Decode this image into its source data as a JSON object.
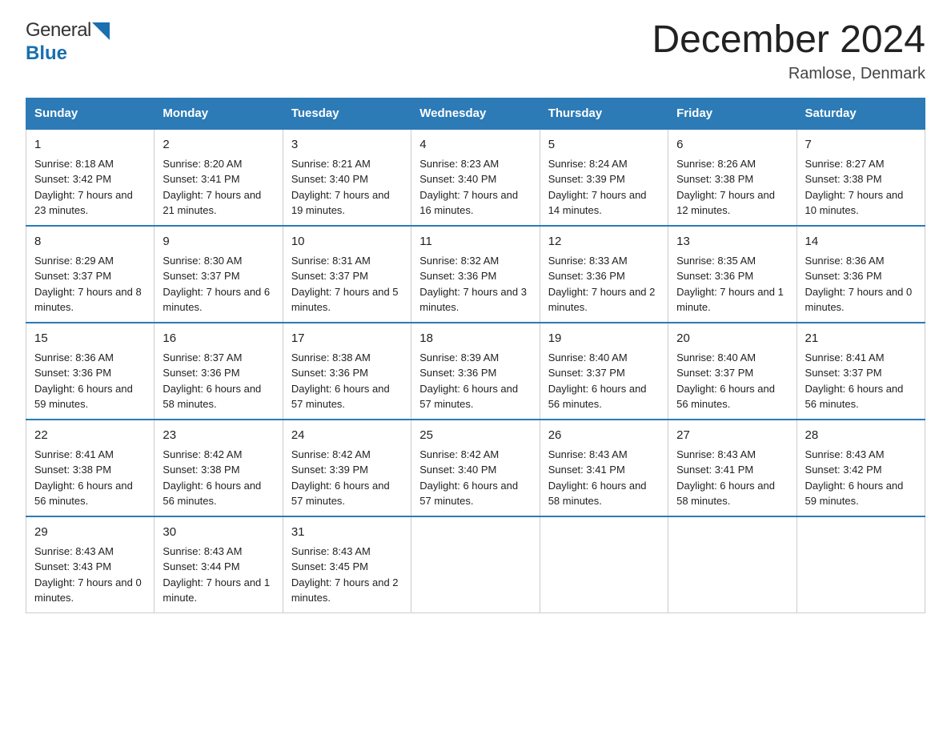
{
  "header": {
    "logo_general": "General",
    "logo_blue": "Blue",
    "title": "December 2024",
    "subtitle": "Ramlose, Denmark"
  },
  "days_of_week": [
    "Sunday",
    "Monday",
    "Tuesday",
    "Wednesday",
    "Thursday",
    "Friday",
    "Saturday"
  ],
  "weeks": [
    [
      {
        "day": "1",
        "sunrise": "8:18 AM",
        "sunset": "3:42 PM",
        "daylight": "7 hours and 23 minutes."
      },
      {
        "day": "2",
        "sunrise": "8:20 AM",
        "sunset": "3:41 PM",
        "daylight": "7 hours and 21 minutes."
      },
      {
        "day": "3",
        "sunrise": "8:21 AM",
        "sunset": "3:40 PM",
        "daylight": "7 hours and 19 minutes."
      },
      {
        "day": "4",
        "sunrise": "8:23 AM",
        "sunset": "3:40 PM",
        "daylight": "7 hours and 16 minutes."
      },
      {
        "day": "5",
        "sunrise": "8:24 AM",
        "sunset": "3:39 PM",
        "daylight": "7 hours and 14 minutes."
      },
      {
        "day": "6",
        "sunrise": "8:26 AM",
        "sunset": "3:38 PM",
        "daylight": "7 hours and 12 minutes."
      },
      {
        "day": "7",
        "sunrise": "8:27 AM",
        "sunset": "3:38 PM",
        "daylight": "7 hours and 10 minutes."
      }
    ],
    [
      {
        "day": "8",
        "sunrise": "8:29 AM",
        "sunset": "3:37 PM",
        "daylight": "7 hours and 8 minutes."
      },
      {
        "day": "9",
        "sunrise": "8:30 AM",
        "sunset": "3:37 PM",
        "daylight": "7 hours and 6 minutes."
      },
      {
        "day": "10",
        "sunrise": "8:31 AM",
        "sunset": "3:37 PM",
        "daylight": "7 hours and 5 minutes."
      },
      {
        "day": "11",
        "sunrise": "8:32 AM",
        "sunset": "3:36 PM",
        "daylight": "7 hours and 3 minutes."
      },
      {
        "day": "12",
        "sunrise": "8:33 AM",
        "sunset": "3:36 PM",
        "daylight": "7 hours and 2 minutes."
      },
      {
        "day": "13",
        "sunrise": "8:35 AM",
        "sunset": "3:36 PM",
        "daylight": "7 hours and 1 minute."
      },
      {
        "day": "14",
        "sunrise": "8:36 AM",
        "sunset": "3:36 PM",
        "daylight": "7 hours and 0 minutes."
      }
    ],
    [
      {
        "day": "15",
        "sunrise": "8:36 AM",
        "sunset": "3:36 PM",
        "daylight": "6 hours and 59 minutes."
      },
      {
        "day": "16",
        "sunrise": "8:37 AM",
        "sunset": "3:36 PM",
        "daylight": "6 hours and 58 minutes."
      },
      {
        "day": "17",
        "sunrise": "8:38 AM",
        "sunset": "3:36 PM",
        "daylight": "6 hours and 57 minutes."
      },
      {
        "day": "18",
        "sunrise": "8:39 AM",
        "sunset": "3:36 PM",
        "daylight": "6 hours and 57 minutes."
      },
      {
        "day": "19",
        "sunrise": "8:40 AM",
        "sunset": "3:37 PM",
        "daylight": "6 hours and 56 minutes."
      },
      {
        "day": "20",
        "sunrise": "8:40 AM",
        "sunset": "3:37 PM",
        "daylight": "6 hours and 56 minutes."
      },
      {
        "day": "21",
        "sunrise": "8:41 AM",
        "sunset": "3:37 PM",
        "daylight": "6 hours and 56 minutes."
      }
    ],
    [
      {
        "day": "22",
        "sunrise": "8:41 AM",
        "sunset": "3:38 PM",
        "daylight": "6 hours and 56 minutes."
      },
      {
        "day": "23",
        "sunrise": "8:42 AM",
        "sunset": "3:38 PM",
        "daylight": "6 hours and 56 minutes."
      },
      {
        "day": "24",
        "sunrise": "8:42 AM",
        "sunset": "3:39 PM",
        "daylight": "6 hours and 57 minutes."
      },
      {
        "day": "25",
        "sunrise": "8:42 AM",
        "sunset": "3:40 PM",
        "daylight": "6 hours and 57 minutes."
      },
      {
        "day": "26",
        "sunrise": "8:43 AM",
        "sunset": "3:41 PM",
        "daylight": "6 hours and 58 minutes."
      },
      {
        "day": "27",
        "sunrise": "8:43 AM",
        "sunset": "3:41 PM",
        "daylight": "6 hours and 58 minutes."
      },
      {
        "day": "28",
        "sunrise": "8:43 AM",
        "sunset": "3:42 PM",
        "daylight": "6 hours and 59 minutes."
      }
    ],
    [
      {
        "day": "29",
        "sunrise": "8:43 AM",
        "sunset": "3:43 PM",
        "daylight": "7 hours and 0 minutes."
      },
      {
        "day": "30",
        "sunrise": "8:43 AM",
        "sunset": "3:44 PM",
        "daylight": "7 hours and 1 minute."
      },
      {
        "day": "31",
        "sunrise": "8:43 AM",
        "sunset": "3:45 PM",
        "daylight": "7 hours and 2 minutes."
      },
      null,
      null,
      null,
      null
    ]
  ],
  "sunrise_label": "Sunrise:",
  "sunset_label": "Sunset:",
  "daylight_label": "Daylight:"
}
